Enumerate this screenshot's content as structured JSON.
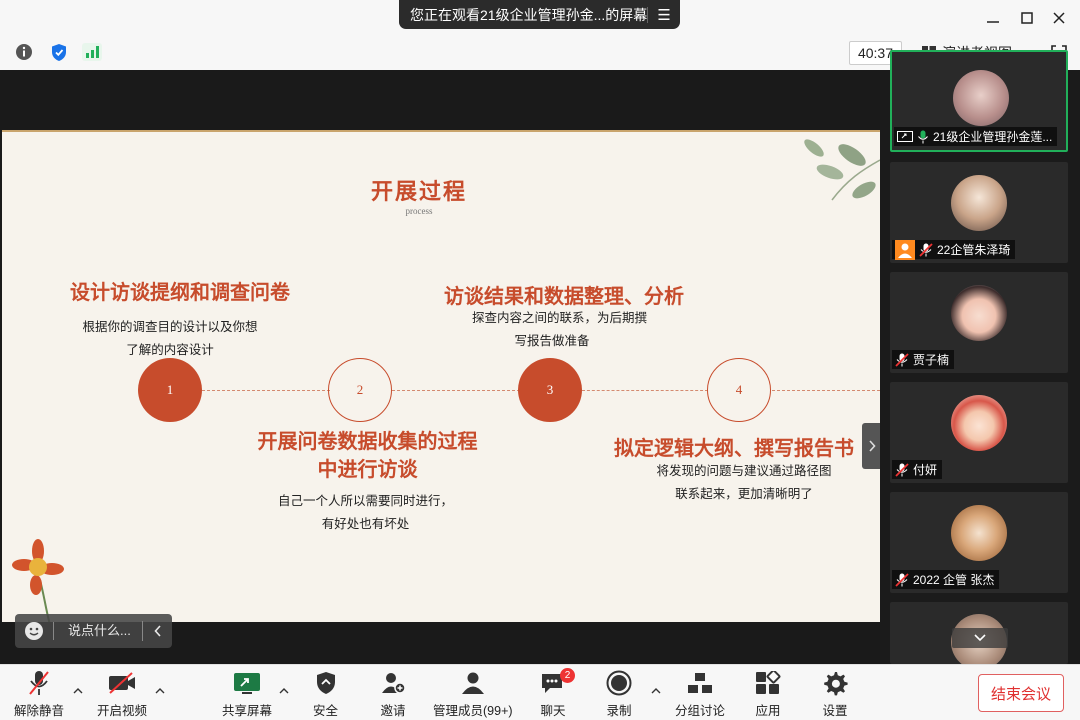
{
  "titlebar": {
    "share_banner_text": "您正在观看21级企业管理孙金...的屏幕",
    "banner_menu_icon": "menu-icon",
    "window_controls": [
      "minimize",
      "maximize",
      "close"
    ]
  },
  "infobar": {
    "timer": "40:37",
    "view_mode_label": "演讲者视图",
    "signal_color": "#21b05a",
    "shield_color": "#1a73e8"
  },
  "slide": {
    "title": "开展过程",
    "subtitle": "process",
    "accent_color": "#c74c2c",
    "steps": [
      {
        "number": "1",
        "heading": "设计访谈提纲和调查问卷",
        "desc_line1": "根据你的调查目的设计以及你想",
        "desc_line2": "了解的内容设计",
        "style": "filled"
      },
      {
        "number": "2",
        "heading_line1": "开展问卷数据收集的过程",
        "heading_line2": "中进行访谈",
        "desc_line1": "自己一个人所以需要同时进行，",
        "desc_line2": "有好处也有坏处",
        "style": "outline"
      },
      {
        "number": "3",
        "heading": "访谈结果和数据整理、分析",
        "desc_line1": "探查内容之间的联系，为后期撰",
        "desc_line2": "写报告做准备",
        "style": "filled"
      },
      {
        "number": "4",
        "heading": "拟定逻辑大纲、撰写报告书",
        "desc_line1": "将发现的问题与建议通过路径图",
        "desc_line2": "联系起来，更加清晰明了",
        "style": "outline"
      }
    ]
  },
  "chat": {
    "placeholder": "说点什么..."
  },
  "gallery": {
    "participants": [
      {
        "name": "21级企业管理孙金莲...",
        "muted": false,
        "sharing": true,
        "active": true
      },
      {
        "name": "22企管朱泽琦",
        "muted": true,
        "sharing": false,
        "active": false
      },
      {
        "name": "贾子楠",
        "muted": true,
        "sharing": false,
        "active": false
      },
      {
        "name": "付妍",
        "muted": true,
        "sharing": false,
        "active": false
      },
      {
        "name": "2022 企管  张杰",
        "muted": true,
        "sharing": false,
        "active": false
      }
    ]
  },
  "toolbar": {
    "unmute": "解除静音",
    "start_video": "开启视频",
    "share_screen": "共享屏幕",
    "security": "安全",
    "invite": "邀请",
    "participants": "管理成员(99+)",
    "chat": "聊天",
    "chat_badge": "2",
    "record": "录制",
    "breakout": "分组讨论",
    "apps": "应用",
    "settings": "设置",
    "end_meeting": "结束会议"
  }
}
